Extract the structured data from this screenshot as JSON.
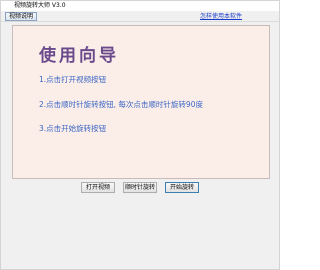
{
  "window": {
    "title": "视频旋转大师 V3.0",
    "icon": "app-video-icon"
  },
  "toolbar": {
    "help_label": "视频说明",
    "howto_link": "怎样使用本软件"
  },
  "guide": {
    "title": "使用向导",
    "steps": [
      "1.点击打开视频按钮",
      "2.点击顺时针旋转按钮, 每次点击顺时针旋转90度",
      "3.点击开始旋转按钮"
    ]
  },
  "buttons": {
    "open": "打开视频",
    "rotate": "顺时针旋转",
    "start": "开始旋转"
  },
  "colors": {
    "panel_bg": "#fbeee9",
    "title_color": "#6b4a8c",
    "step_color": "#3b66c4",
    "link_color": "#1a3cc8"
  }
}
